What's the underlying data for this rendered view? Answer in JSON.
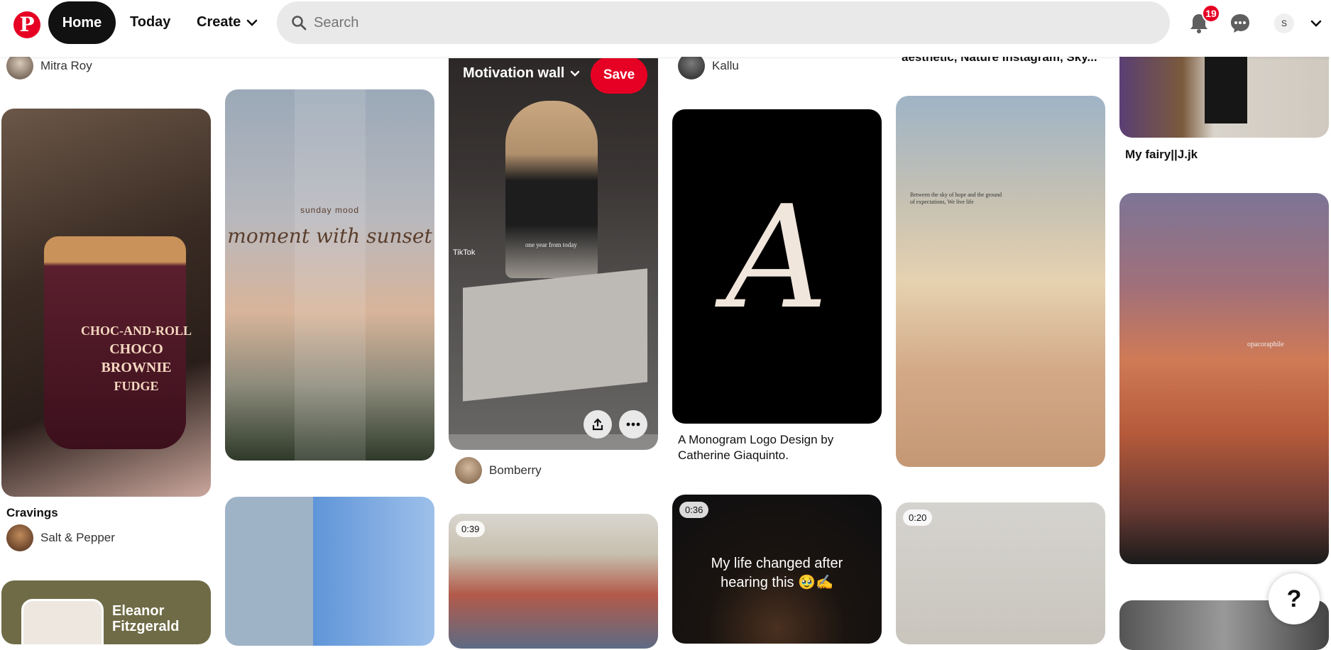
{
  "nav": {
    "logo": "P",
    "home": "Home",
    "today": "Today",
    "create": "Create",
    "search_placeholder": "Search",
    "notifications_count": "19",
    "avatar_initial": "S"
  },
  "pins": {
    "col1_top_user": "Mitra Roy",
    "icecream_brand": "CHOC-AND-ROLL",
    "icecream_name": "CHOCO BROWNIE",
    "icecream_sub": "FUDGE",
    "icecream_title": "Cravings",
    "icecream_user": "Salt & Pepper",
    "eleanor_text": "Eleanor Fitzgerald",
    "sunset_small": "sunday mood",
    "sunset_script": "moment with sunset",
    "motivation_board": "Motivation wall",
    "save_label": "Save",
    "tiktok_label": "TikTok",
    "motivation_overlay": "one year from today",
    "motivation_user": "Bomberry",
    "video1_time": "0:39",
    "col4_top_user": "Kallu",
    "monogram_letter": "A",
    "monogram_title": "A Monogram Logo Design by Catherine Giaquinto.",
    "video2_time": "0:36",
    "video2_text": "My life changed after hearing this 🥹✍️",
    "col5_top_text": "aesthetic, Nature Instagram, Sky...",
    "clouds_quote": "Between the sky of hope and the ground of expectations, We live life",
    "video3_time": "0:20",
    "fairy_title": "My fairy||J.jk",
    "orange_sky_watermark": "opacoraphile"
  },
  "help": "?"
}
